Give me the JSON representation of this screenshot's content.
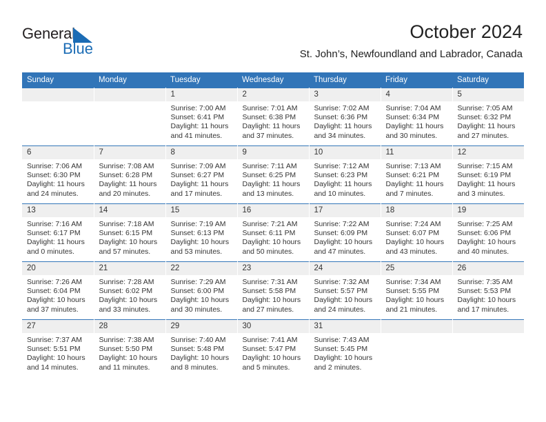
{
  "brand": {
    "name_part1": "General",
    "name_part2": "Blue",
    "accent_color": "#1b6cb5",
    "triangle_icon": "triangle-icon"
  },
  "header": {
    "title": "October 2024",
    "subtitle": "St. John’s, Newfoundland and Labrador, Canada"
  },
  "calendar": {
    "header_color": "#3275b8",
    "daynum_bg": "#efefef",
    "weekdays": [
      "Sunday",
      "Monday",
      "Tuesday",
      "Wednesday",
      "Thursday",
      "Friday",
      "Saturday"
    ],
    "weeks": [
      [
        {
          "day": "",
          "sunrise": "",
          "sunset": "",
          "daylight1": "",
          "daylight2": ""
        },
        {
          "day": "",
          "sunrise": "",
          "sunset": "",
          "daylight1": "",
          "daylight2": ""
        },
        {
          "day": "1",
          "sunrise": "Sunrise: 7:00 AM",
          "sunset": "Sunset: 6:41 PM",
          "daylight1": "Daylight: 11 hours",
          "daylight2": "and 41 minutes."
        },
        {
          "day": "2",
          "sunrise": "Sunrise: 7:01 AM",
          "sunset": "Sunset: 6:38 PM",
          "daylight1": "Daylight: 11 hours",
          "daylight2": "and 37 minutes."
        },
        {
          "day": "3",
          "sunrise": "Sunrise: 7:02 AM",
          "sunset": "Sunset: 6:36 PM",
          "daylight1": "Daylight: 11 hours",
          "daylight2": "and 34 minutes."
        },
        {
          "day": "4",
          "sunrise": "Sunrise: 7:04 AM",
          "sunset": "Sunset: 6:34 PM",
          "daylight1": "Daylight: 11 hours",
          "daylight2": "and 30 minutes."
        },
        {
          "day": "5",
          "sunrise": "Sunrise: 7:05 AM",
          "sunset": "Sunset: 6:32 PM",
          "daylight1": "Daylight: 11 hours",
          "daylight2": "and 27 minutes."
        }
      ],
      [
        {
          "day": "6",
          "sunrise": "Sunrise: 7:06 AM",
          "sunset": "Sunset: 6:30 PM",
          "daylight1": "Daylight: 11 hours",
          "daylight2": "and 24 minutes."
        },
        {
          "day": "7",
          "sunrise": "Sunrise: 7:08 AM",
          "sunset": "Sunset: 6:28 PM",
          "daylight1": "Daylight: 11 hours",
          "daylight2": "and 20 minutes."
        },
        {
          "day": "8",
          "sunrise": "Sunrise: 7:09 AM",
          "sunset": "Sunset: 6:27 PM",
          "daylight1": "Daylight: 11 hours",
          "daylight2": "and 17 minutes."
        },
        {
          "day": "9",
          "sunrise": "Sunrise: 7:11 AM",
          "sunset": "Sunset: 6:25 PM",
          "daylight1": "Daylight: 11 hours",
          "daylight2": "and 13 minutes."
        },
        {
          "day": "10",
          "sunrise": "Sunrise: 7:12 AM",
          "sunset": "Sunset: 6:23 PM",
          "daylight1": "Daylight: 11 hours",
          "daylight2": "and 10 minutes."
        },
        {
          "day": "11",
          "sunrise": "Sunrise: 7:13 AM",
          "sunset": "Sunset: 6:21 PM",
          "daylight1": "Daylight: 11 hours",
          "daylight2": "and 7 minutes."
        },
        {
          "day": "12",
          "sunrise": "Sunrise: 7:15 AM",
          "sunset": "Sunset: 6:19 PM",
          "daylight1": "Daylight: 11 hours",
          "daylight2": "and 3 minutes."
        }
      ],
      [
        {
          "day": "13",
          "sunrise": "Sunrise: 7:16 AM",
          "sunset": "Sunset: 6:17 PM",
          "daylight1": "Daylight: 11 hours",
          "daylight2": "and 0 minutes."
        },
        {
          "day": "14",
          "sunrise": "Sunrise: 7:18 AM",
          "sunset": "Sunset: 6:15 PM",
          "daylight1": "Daylight: 10 hours",
          "daylight2": "and 57 minutes."
        },
        {
          "day": "15",
          "sunrise": "Sunrise: 7:19 AM",
          "sunset": "Sunset: 6:13 PM",
          "daylight1": "Daylight: 10 hours",
          "daylight2": "and 53 minutes."
        },
        {
          "day": "16",
          "sunrise": "Sunrise: 7:21 AM",
          "sunset": "Sunset: 6:11 PM",
          "daylight1": "Daylight: 10 hours",
          "daylight2": "and 50 minutes."
        },
        {
          "day": "17",
          "sunrise": "Sunrise: 7:22 AM",
          "sunset": "Sunset: 6:09 PM",
          "daylight1": "Daylight: 10 hours",
          "daylight2": "and 47 minutes."
        },
        {
          "day": "18",
          "sunrise": "Sunrise: 7:24 AM",
          "sunset": "Sunset: 6:07 PM",
          "daylight1": "Daylight: 10 hours",
          "daylight2": "and 43 minutes."
        },
        {
          "day": "19",
          "sunrise": "Sunrise: 7:25 AM",
          "sunset": "Sunset: 6:06 PM",
          "daylight1": "Daylight: 10 hours",
          "daylight2": "and 40 minutes."
        }
      ],
      [
        {
          "day": "20",
          "sunrise": "Sunrise: 7:26 AM",
          "sunset": "Sunset: 6:04 PM",
          "daylight1": "Daylight: 10 hours",
          "daylight2": "and 37 minutes."
        },
        {
          "day": "21",
          "sunrise": "Sunrise: 7:28 AM",
          "sunset": "Sunset: 6:02 PM",
          "daylight1": "Daylight: 10 hours",
          "daylight2": "and 33 minutes."
        },
        {
          "day": "22",
          "sunrise": "Sunrise: 7:29 AM",
          "sunset": "Sunset: 6:00 PM",
          "daylight1": "Daylight: 10 hours",
          "daylight2": "and 30 minutes."
        },
        {
          "day": "23",
          "sunrise": "Sunrise: 7:31 AM",
          "sunset": "Sunset: 5:58 PM",
          "daylight1": "Daylight: 10 hours",
          "daylight2": "and 27 minutes."
        },
        {
          "day": "24",
          "sunrise": "Sunrise: 7:32 AM",
          "sunset": "Sunset: 5:57 PM",
          "daylight1": "Daylight: 10 hours",
          "daylight2": "and 24 minutes."
        },
        {
          "day": "25",
          "sunrise": "Sunrise: 7:34 AM",
          "sunset": "Sunset: 5:55 PM",
          "daylight1": "Daylight: 10 hours",
          "daylight2": "and 21 minutes."
        },
        {
          "day": "26",
          "sunrise": "Sunrise: 7:35 AM",
          "sunset": "Sunset: 5:53 PM",
          "daylight1": "Daylight: 10 hours",
          "daylight2": "and 17 minutes."
        }
      ],
      [
        {
          "day": "27",
          "sunrise": "Sunrise: 7:37 AM",
          "sunset": "Sunset: 5:51 PM",
          "daylight1": "Daylight: 10 hours",
          "daylight2": "and 14 minutes."
        },
        {
          "day": "28",
          "sunrise": "Sunrise: 7:38 AM",
          "sunset": "Sunset: 5:50 PM",
          "daylight1": "Daylight: 10 hours",
          "daylight2": "and 11 minutes."
        },
        {
          "day": "29",
          "sunrise": "Sunrise: 7:40 AM",
          "sunset": "Sunset: 5:48 PM",
          "daylight1": "Daylight: 10 hours",
          "daylight2": "and 8 minutes."
        },
        {
          "day": "30",
          "sunrise": "Sunrise: 7:41 AM",
          "sunset": "Sunset: 5:47 PM",
          "daylight1": "Daylight: 10 hours",
          "daylight2": "and 5 minutes."
        },
        {
          "day": "31",
          "sunrise": "Sunrise: 7:43 AM",
          "sunset": "Sunset: 5:45 PM",
          "daylight1": "Daylight: 10 hours",
          "daylight2": "and 2 minutes."
        },
        {
          "day": "",
          "sunrise": "",
          "sunset": "",
          "daylight1": "",
          "daylight2": ""
        },
        {
          "day": "",
          "sunrise": "",
          "sunset": "",
          "daylight1": "",
          "daylight2": ""
        }
      ]
    ]
  }
}
